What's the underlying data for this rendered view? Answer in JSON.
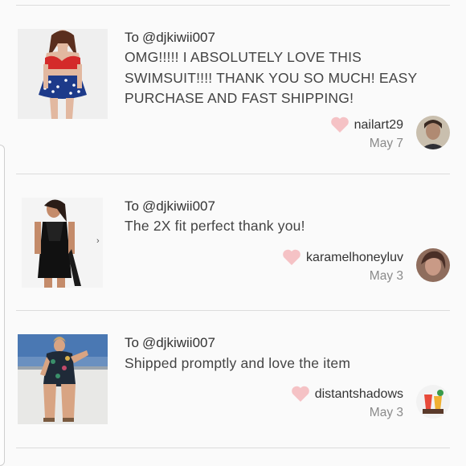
{
  "reviews": [
    {
      "to_prefix": "To",
      "to_handle": "@djkiwii007",
      "comment": "OMG!!!!! I ABSOLUTELY LOVE THIS SWIMSUIT!!!! THANK YOU SO MUCH! EASY PURCHASE AND FAST SHIPPING!",
      "username": "nailart29",
      "date": "May 7"
    },
    {
      "to_prefix": "To",
      "to_handle": "@djkiwii007",
      "comment": "The 2X fit perfect thank you!",
      "username": "karamelhoneyluv",
      "date": "May 3",
      "thumb_chevron": "›"
    },
    {
      "to_prefix": "To",
      "to_handle": "@djkiwii007",
      "comment": "Shipped promptly and love the item",
      "username": "distantshadows",
      "date": "May 3"
    }
  ],
  "colors": {
    "heart": "#f5c2c5",
    "divider": "#dcdcdc",
    "text": "#444444",
    "muted": "#8a8a8a"
  },
  "icons": {
    "like": "heart-icon"
  }
}
